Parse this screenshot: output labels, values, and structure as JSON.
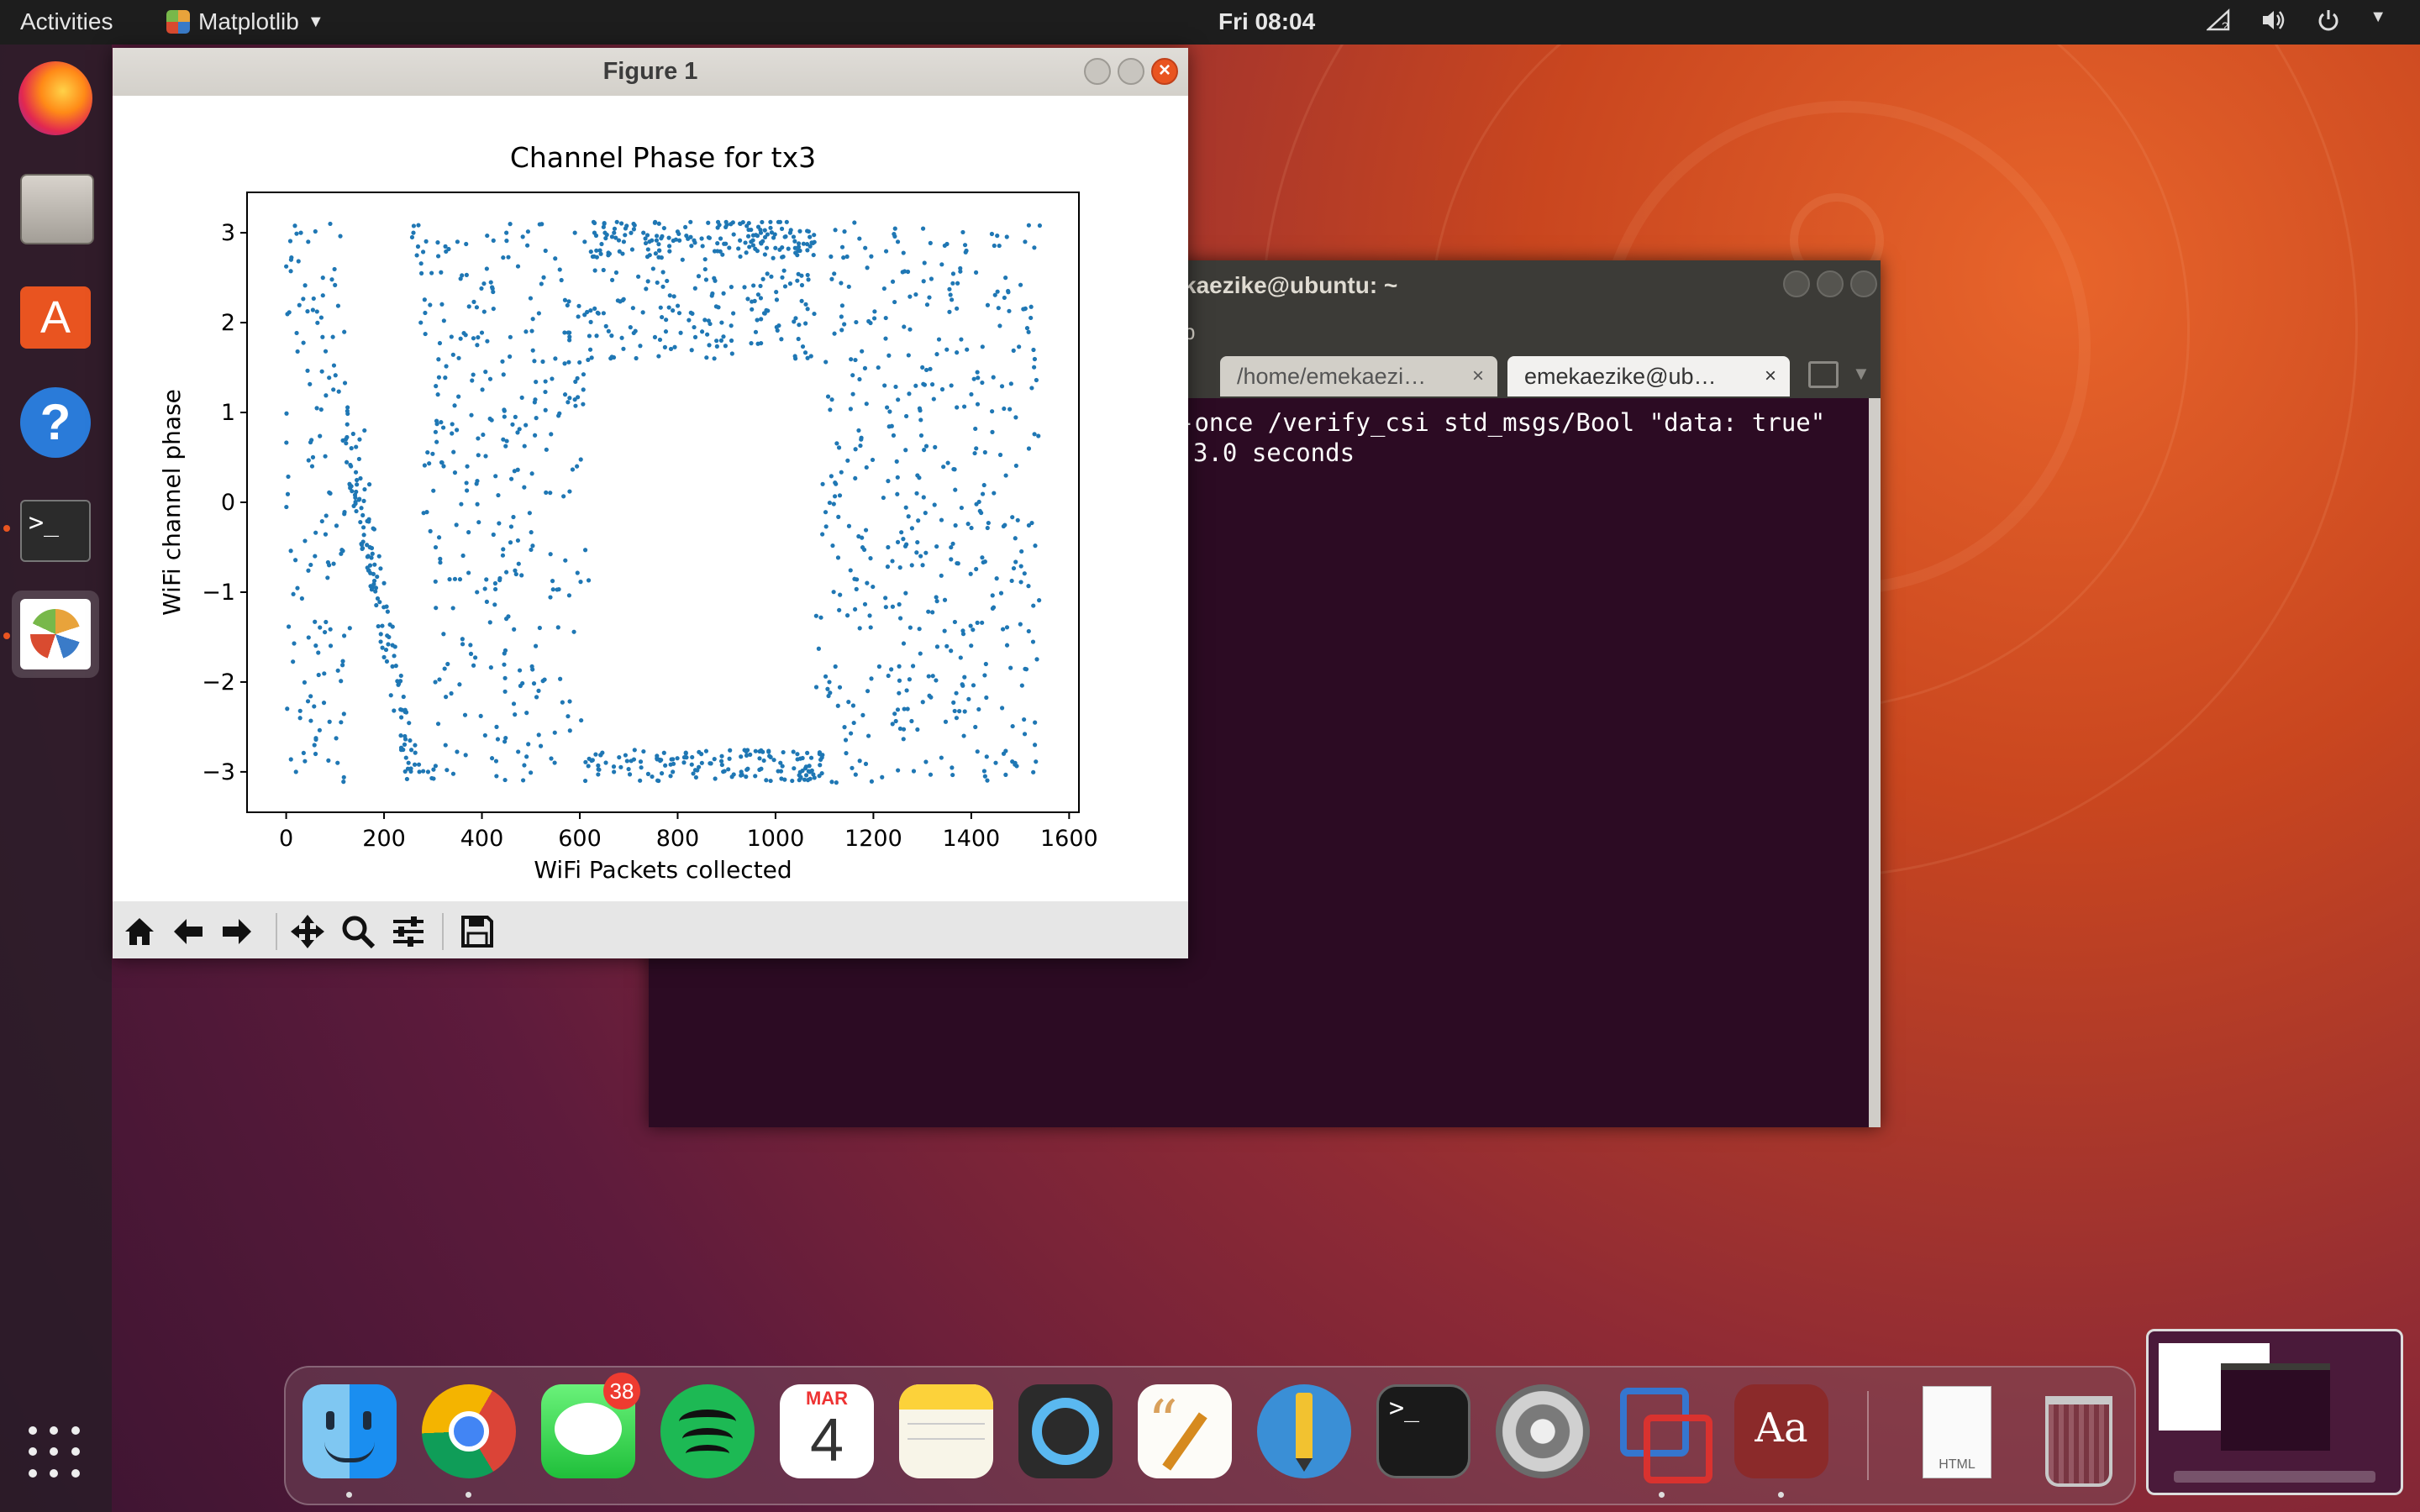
{
  "topbar": {
    "activities": "Activities",
    "app_name": "Matplotlib",
    "clock": "Fri 08:04"
  },
  "figure": {
    "title": "Figure 1"
  },
  "terminal": {
    "title": "emekaezike@ubuntu: ~",
    "menu_fragment": "p",
    "tabs": [
      "/home/emekaezi…",
      "emekaezike@ub…"
    ],
    "lines": [
      "-once /verify_csi std_msgs/Bool \"data: true\"",
      "3.0 seconds"
    ]
  },
  "dock": {
    "calendar_month": "MAR",
    "calendar_day": "4",
    "messages_badge": "38",
    "dict_label": "Aa",
    "html_label": "HTML"
  },
  "colors": {
    "accent": "#e95420",
    "scatter": "#1f77b4",
    "terminal_bg": "#2c0b23"
  },
  "chart_data": {
    "type": "scatter",
    "title": "Channel Phase for tx3",
    "xlabel": "WiFi Packets collected",
    "ylabel": "WiFi channel phase",
    "xlim": [
      -80,
      1620
    ],
    "ylim": [
      -3.45,
      3.45
    ],
    "xticks": [
      0,
      200,
      400,
      600,
      800,
      1000,
      1200,
      1400,
      1600
    ],
    "yticks": [
      -3,
      -2,
      -1,
      0,
      1,
      2,
      3
    ],
    "n_points": 1540,
    "series": [
      {
        "x": [
          10,
          20,
          30,
          45,
          60,
          75,
          90,
          105,
          130,
          150,
          160,
          170,
          180,
          190,
          200,
          210,
          230,
          250,
          260,
          275,
          290,
          310,
          330,
          350,
          370,
          390,
          410,
          430,
          450,
          470,
          490,
          510,
          530,
          550,
          570,
          590,
          610,
          630,
          650,
          670,
          690,
          710,
          730,
          750,
          770,
          790,
          810,
          830,
          850,
          870,
          890,
          910,
          930,
          950,
          970,
          990,
          1010,
          1030,
          1050,
          1070,
          1090,
          1110,
          1130,
          1150,
          1170,
          1190,
          1210,
          1230,
          1250,
          1270,
          1290,
          1310,
          1330,
          1350,
          1370,
          1390,
          1410,
          1430,
          1450,
          1470,
          1490,
          1510,
          1530
        ],
        "y": [
          2.7,
          -3.0,
          3.0,
          2.9,
          -2.8,
          2.5,
          3.1,
          -2.9,
          -1.4,
          0.7,
          0.8,
          0.2,
          -0.3,
          -0.6,
          -0.9,
          -1.5,
          -2.0,
          -2.9,
          3.0,
          2.0,
          -3.0,
          1.2,
          -1.8,
          2.9,
          0.4,
          -1.0,
          2.6,
          -2.5,
          3.0,
          -0.8,
          1.9,
          -1.6,
          2.8,
          1.6,
          1.2,
          3.0,
          2.9,
          3.0,
          3.1,
          3.0,
          2.9,
          3.1,
          3.0,
          2.6,
          2.4,
          -3.0,
          2.7,
          2.1,
          1.9,
          2.3,
          2.0,
          1.8,
          -3.0,
          2.9,
          3.0,
          -3.1,
          -2.9,
          3.0,
          2.8,
          -3.0,
          -2.8,
          -2.0,
          -1.2,
          2.4,
          0.8,
          -2.6,
          1.5,
          -0.5,
          2.9,
          -2.3,
          0.3,
          2.2,
          -1.1,
          1.7,
          -2.4,
          2.8,
          0.6,
          -1.8,
          -2.9,
          2.5,
          -0.4,
          2.9,
          -2.7
        ]
      }
    ]
  }
}
